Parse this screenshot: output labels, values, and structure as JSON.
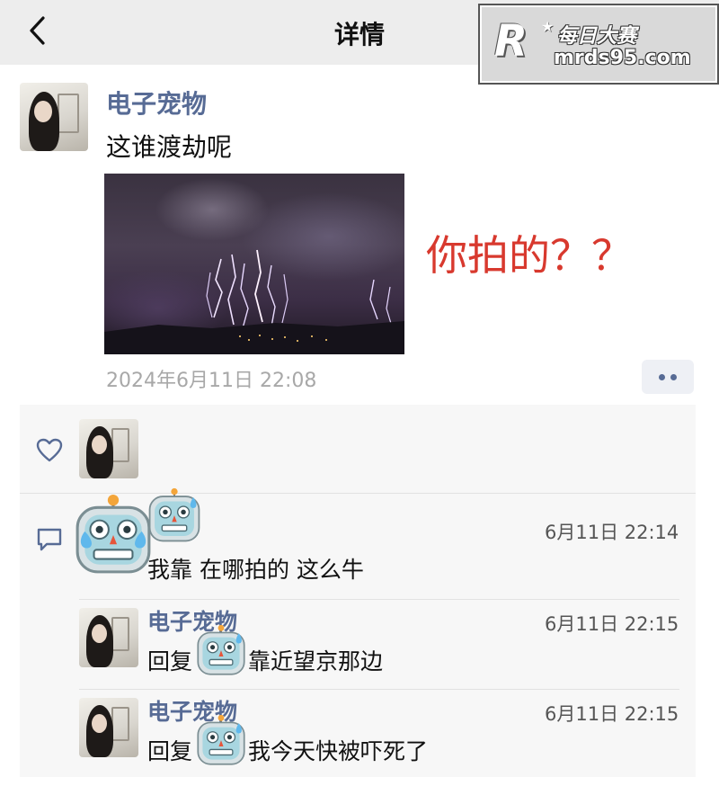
{
  "nav": {
    "title": "详情",
    "back_icon": "chevron-left-icon"
  },
  "watermark": {
    "logo": "R",
    "brand": "每日大赛",
    "url": "mrds95.com"
  },
  "post": {
    "author": "电子宠物",
    "text": "这谁渡劫呢",
    "annotation": "你拍的？？",
    "timestamp": "2024年6月11日 22:08",
    "more_icon": "more-dots-icon"
  },
  "likes": {
    "icon": "heart-outline-icon"
  },
  "comments": {
    "icon": "comment-bubble-icon",
    "items": [
      {
        "time": "6月11日 22:14",
        "text": "我靠 在哪拍的 这么牛"
      },
      {
        "author": "电子宠物",
        "time": "6月11日 22:15",
        "reply_prefix": "回复",
        "text": "靠近望京那边"
      },
      {
        "author": "电子宠物",
        "time": "6月11日 22:15",
        "reply_prefix": "回复",
        "text": "我今天快被吓死了"
      }
    ]
  }
}
